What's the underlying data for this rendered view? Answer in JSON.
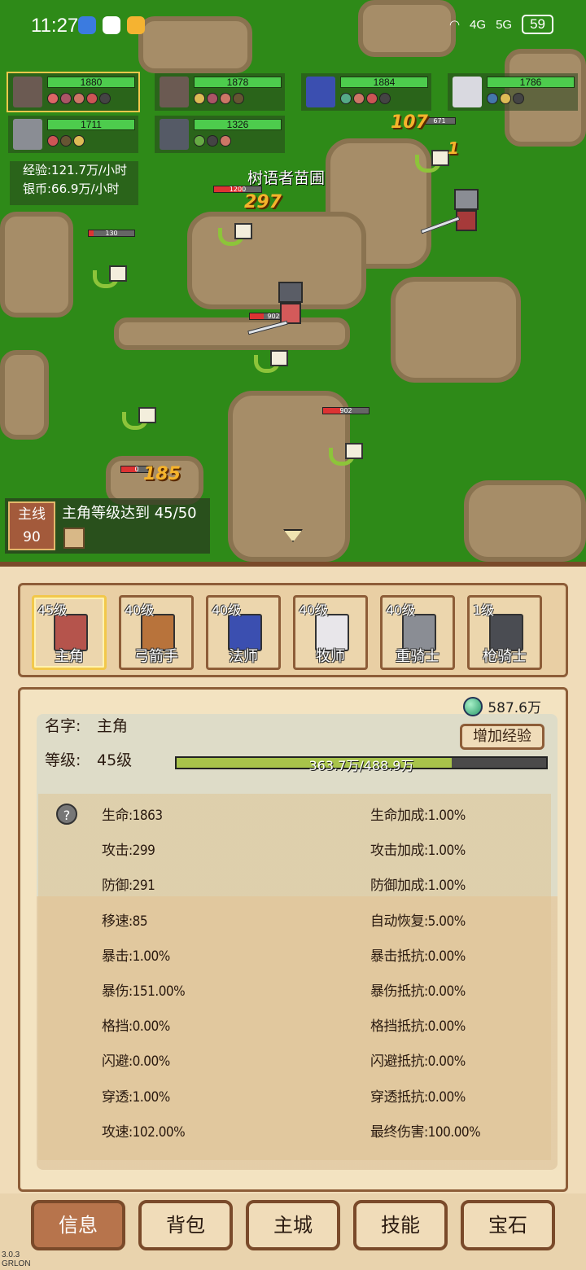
{
  "status_bar": {
    "time": "11:27",
    "signal_1": "4G",
    "signal_2": "5G",
    "battery": "59"
  },
  "heroes": [
    {
      "hp": "1880"
    },
    {
      "hp": "1878"
    },
    {
      "hp": "1884"
    },
    {
      "hp": "1786"
    },
    {
      "hp": "1711"
    },
    {
      "hp": "1326"
    }
  ],
  "rates": {
    "exp": "经验:121.7万/小时",
    "silver": "银币:66.9万/小时"
  },
  "battle": {
    "map_name": "树语者苗圃",
    "mob_hp": [
      "1200",
      "671",
      "130",
      "902",
      "902",
      "0"
    ],
    "damage": [
      "107",
      "1",
      "297",
      "185"
    ]
  },
  "quest": {
    "tag": "主线",
    "number": "90",
    "text": "主角等级达到 45/50"
  },
  "roster": [
    {
      "level": "45级",
      "name": "主角"
    },
    {
      "level": "40级",
      "name": "弓箭手"
    },
    {
      "level": "40级",
      "name": "法师"
    },
    {
      "level": "40级",
      "name": "牧师"
    },
    {
      "level": "40级",
      "name": "重骑士"
    },
    {
      "level": "1级",
      "name": "枪骑士"
    }
  ],
  "info": {
    "gems": "587.6万",
    "add_exp": "增加经验",
    "name_label": "名字:",
    "name": "主角",
    "level_label": "等级:",
    "level": "45级",
    "exp_text": "363.7万/488.9万",
    "exp_fraction": 0.744,
    "help": "?",
    "stats_left": [
      "生命:1863",
      "攻击:299",
      "防御:291",
      "移速:85",
      "暴击:1.00%",
      "暴伤:151.00%",
      "格挡:0.00%",
      "闪避:0.00%",
      "穿透:1.00%",
      "攻速:102.00%"
    ],
    "stats_right": [
      "生命加成:1.00%",
      "攻击加成:1.00%",
      "防御加成:1.00%",
      "自动恢复:5.00%",
      "暴击抵抗:0.00%",
      "暴伤抵抗:0.00%",
      "格挡抵抗:0.00%",
      "闪避抵抗:0.00%",
      "穿透抵抗:0.00%",
      "最终伤害:100.00%"
    ]
  },
  "tabs": [
    "信息",
    "背包",
    "主城",
    "技能",
    "宝石"
  ],
  "version": {
    "number": "3.0.3",
    "studio": "GRLON"
  }
}
